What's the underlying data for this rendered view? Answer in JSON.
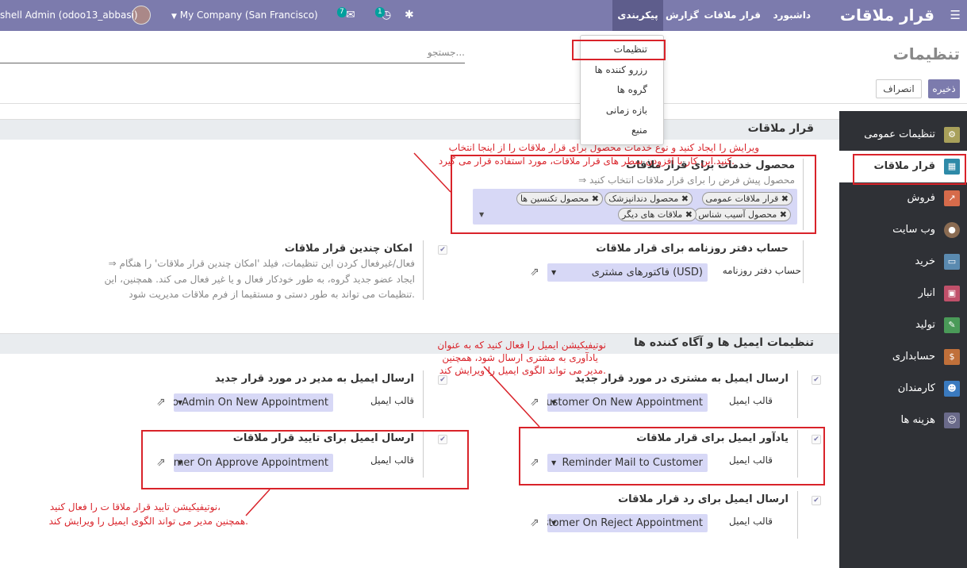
{
  "topbar": {
    "app_title": "قرار ملاقات",
    "menu": [
      "داشبورد",
      "قرار ملاقات",
      "گزارش",
      "پیکربندی"
    ],
    "company": "My Company (San Francisco)",
    "user": "shell Admin (odoo13_abbasi)",
    "chat_count": "7",
    "activity_count": "1"
  },
  "config_menu": [
    "تنظیمات",
    "رزرو کننده ها",
    "گروه ها",
    "بازه زمانی",
    "منبع"
  ],
  "page": {
    "title": "تنظیمات",
    "search_placeholder": "جستجو...",
    "save": "ذخیره",
    "cancel": "انصراف"
  },
  "sidebar": [
    "تنظیمات عمومی",
    "قرار ملاقات",
    "فروش",
    "وب سایت",
    "خرید",
    "انبار",
    "تولید",
    "حسابداری",
    "کارمندان",
    "هزینه ها"
  ],
  "sections": {
    "appointment": "قرار ملاقات",
    "email": "تنظیمات ایمیل ها و آگاه کننده ها"
  },
  "product": {
    "title": "محصول خدمات برای قرار ملاقات",
    "help": "⇒ محصول پیش فرض را برای قرار ملاقات انتخاب کنید",
    "tags": [
      "قرار ملاقات عمومی",
      "محصول دندانپزشک",
      "محصول تکنسین ها",
      "محصول آسیب شناس",
      "ملاقات های دیگر"
    ]
  },
  "journal": {
    "title": "حساب دفتر روزنامه برای قرار ملاقات",
    "label": "حساب دفتر روزنامه",
    "value": "فاکتورهای مشتری (USD)"
  },
  "multi": {
    "title": "امکان چندین قرار ملاقات",
    "line1": "⇒ فعال/غیرفعال کردن این تنظیمات، فیلد 'امکان چندین قرار ملاقات' را هنگام",
    "line2": "ایجاد عضو جدید گروه، به طور خودکار فعال و یا غیر فعال می کند. همچنین، این",
    "line3": "تنظیمات می تواند به طور دستی و مستقیما از فرم ملاقات مدیریت شود."
  },
  "emails": {
    "template_label": "قالب ایمیل",
    "customer_new": {
      "title": "ارسال ایمیل به مشتری در مورد قرار جدید",
      "value": "Customer On New Appointment"
    },
    "admin_new": {
      "title": "ارسال ایمیل به مدیر در مورد قرار جدید",
      "value": "to Admin On New Appointment"
    },
    "reminder": {
      "title": "یادآور ایمیل برای قرار ملاقات",
      "value": "Reminder Mail to Customer"
    },
    "approve": {
      "title": "ارسال ایمیل برای تایید قرار ملاقات",
      "value": "tomer On Approve Appointment"
    },
    "reject": {
      "title": "ارسال ایمیل برای رد قرار ملاقات",
      "value": "ustomer On Reject Appointment"
    }
  },
  "notes": {
    "product_1": "ویرایش را ایجاد کنید و نوع خدمات محصول برای قرار ملاقات را از اینجا انتخاب",
    "product_2": "کنید.این کار با افزودن سطر های قرار ملاقات، مورد استفاده قرار می گیرد.",
    "reminder_1": "نوتیفیکیشن ایمیل را فعال کنید که به عنوان",
    "reminder_2": "یادآوری به مشتری ارسال شود، همچنین",
    "reminder_3": "مدیر می تواند الگوی ایمیل را ویرایش کند.",
    "approve_1": "نوتیفیکیشن تایید قرار ملاقا ت را فعال کنید،",
    "approve_2": "همچنین مدیر می تواند الگوی ایمیل را ویرایش کند."
  },
  "colors": {
    "brand": "#7c7bad",
    "annotation": "#d9232a",
    "sidebar": "#2f3136"
  }
}
